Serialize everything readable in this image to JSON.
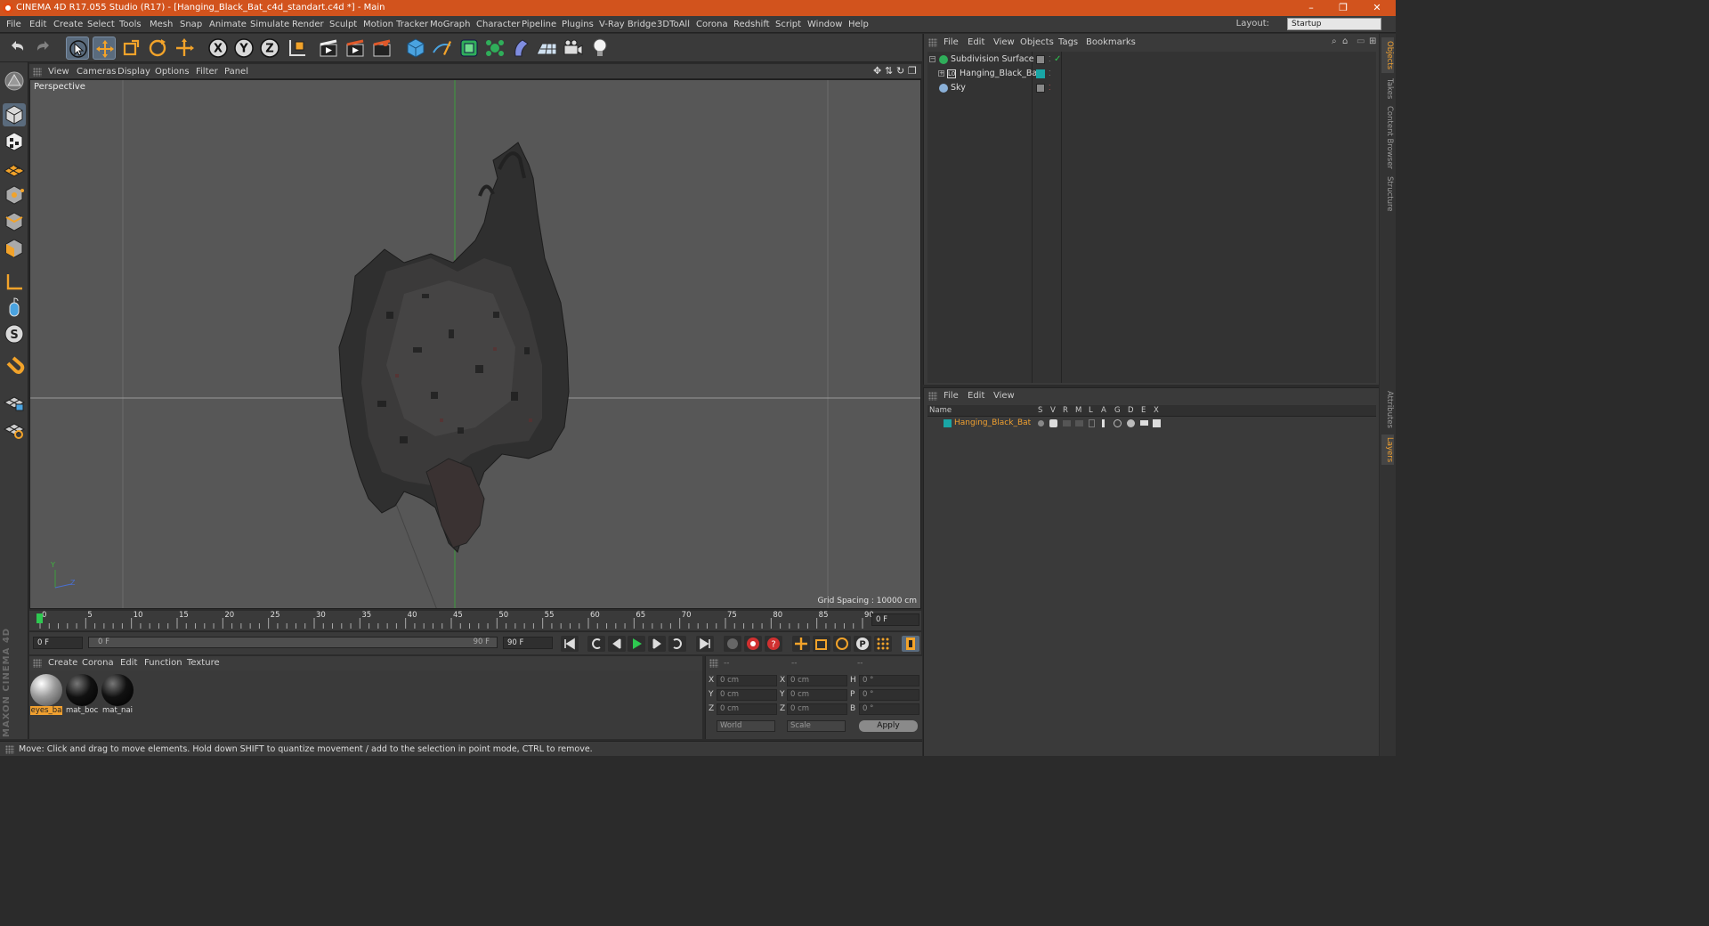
{
  "window": {
    "title": "CINEMA 4D R17.055 Studio (R17) - [Hanging_Black_Bat_c4d_standart.c4d *] - Main",
    "controls": [
      "–",
      "❐",
      "✕"
    ]
  },
  "menubar": {
    "items": [
      "File",
      "Edit",
      "Create",
      "Select",
      "Tools",
      "Mesh",
      "Snap",
      "Animate",
      "Simulate",
      "Render",
      "Sculpt",
      "Motion Tracker",
      "MoGraph",
      "Character",
      "Pipeline",
      "Plugins",
      "V-Ray Bridge",
      "3DToAll",
      "Corona",
      "Redshift",
      "Script",
      "Window",
      "Help"
    ],
    "layout_label": "Layout:",
    "layout_value": "Startup"
  },
  "viewport": {
    "menu": [
      "View",
      "Cameras",
      "Display",
      "Options",
      "Filter",
      "Panel"
    ],
    "label": "Perspective",
    "grid_spacing": "Grid Spacing : 10000 cm",
    "axis_y": "Y",
    "axis_z": "Z"
  },
  "timeline": {
    "ticks": [
      "0",
      "5",
      "10",
      "15",
      "20",
      "25",
      "30",
      "35",
      "40",
      "45",
      "50",
      "55",
      "60",
      "65",
      "70",
      "75",
      "80",
      "85",
      "90"
    ],
    "current_frame": "0 F",
    "start_field": "0 F",
    "range_start": "0 F",
    "range_end": "90 F",
    "end_field": "90 F"
  },
  "materials": {
    "menu": [
      "Create",
      "Corona",
      "Edit",
      "Function",
      "Texture"
    ],
    "items": [
      {
        "label": "eyes_ba",
        "selected": true
      },
      {
        "label": "mat_boc",
        "selected": false
      },
      {
        "label": "mat_nai",
        "selected": false
      }
    ]
  },
  "coordinates": {
    "header": [
      "--",
      "--",
      "--"
    ],
    "rows": [
      {
        "a": "X",
        "av": "0 cm",
        "b": "X",
        "bv": "0 cm",
        "c": "H",
        "cv": "0 °"
      },
      {
        "a": "Y",
        "av": "0 cm",
        "b": "Y",
        "bv": "0 cm",
        "c": "P",
        "cv": "0 °"
      },
      {
        "a": "Z",
        "av": "0 cm",
        "b": "Z",
        "bv": "0 cm",
        "c": "B",
        "cv": "0 °"
      }
    ],
    "world": "World",
    "scale": "Scale",
    "apply": "Apply"
  },
  "status": "Move: Click and drag to move elements. Hold down SHIFT to quantize movement / add to the selection in point mode, CTRL to remove.",
  "objects": {
    "menu": [
      "File",
      "Edit",
      "View",
      "Objects",
      "Tags",
      "Bookmarks"
    ],
    "rows": [
      {
        "name": "Subdivision Surface",
        "indent": 0
      },
      {
        "name": "Hanging_Black_Bat",
        "indent": 1
      },
      {
        "name": "Sky",
        "indent": 0
      }
    ]
  },
  "layers": {
    "menu": [
      "File",
      "Edit",
      "View"
    ],
    "columns": [
      "Name",
      "S",
      "V",
      "R",
      "M",
      "L",
      "A",
      "G",
      "D",
      "E",
      "X"
    ],
    "row": "Hanging_Black_Bat"
  },
  "side_tabs": [
    "Objects",
    "Takes",
    "Content Browser",
    "Structure",
    "Attributes",
    "Layers"
  ],
  "brand": "MAXON CINEMA 4D",
  "colors": {
    "accent": "#d2531d",
    "layer_orange": "#f0a030",
    "teal": "#19a6a6"
  }
}
